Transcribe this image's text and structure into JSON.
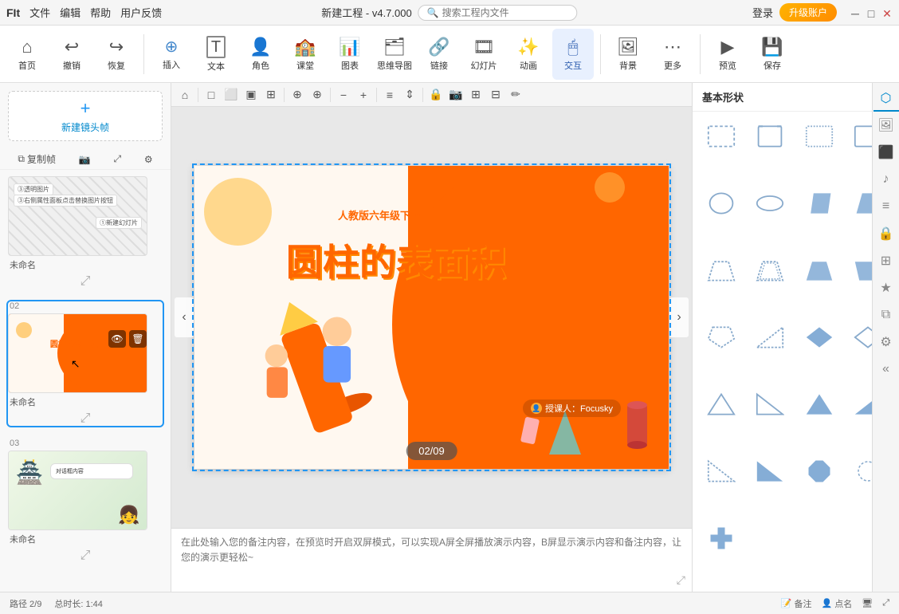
{
  "app": {
    "title": "新建工程 - v4.7.000",
    "search_placeholder": "搜索工程内文件"
  },
  "title_bar": {
    "menus": [
      "FIt",
      "文件",
      "编辑",
      "帮助",
      "用户反馈"
    ],
    "login": "登录",
    "upgrade": "升级账户"
  },
  "toolbar": {
    "items": [
      {
        "id": "home",
        "label": "首页",
        "icon": "⌂"
      },
      {
        "id": "undo",
        "label": "撤销",
        "icon": "↩"
      },
      {
        "id": "redo",
        "label": "恢复",
        "icon": "↪"
      },
      {
        "id": "insert",
        "label": "插入",
        "icon": "⊕"
      },
      {
        "id": "text",
        "label": "文本",
        "icon": "T"
      },
      {
        "id": "role",
        "label": "角色",
        "icon": "👤"
      },
      {
        "id": "class",
        "label": "课堂",
        "icon": "🏫"
      },
      {
        "id": "chart",
        "label": "图表",
        "icon": "📊"
      },
      {
        "id": "mindmap",
        "label": "思维导图",
        "icon": "🗂"
      },
      {
        "id": "link",
        "label": "链接",
        "icon": "🔗"
      },
      {
        "id": "slide",
        "label": "幻灯片",
        "icon": "🎞"
      },
      {
        "id": "animate",
        "label": "动画",
        "icon": "✨"
      },
      {
        "id": "interact",
        "label": "交互",
        "icon": "🖱"
      },
      {
        "id": "bg",
        "label": "背景",
        "icon": "🖼"
      },
      {
        "id": "more",
        "label": "更多",
        "icon": "⋯"
      },
      {
        "id": "preview",
        "label": "预览",
        "icon": "▶"
      },
      {
        "id": "save",
        "label": "保存",
        "icon": "💾"
      }
    ]
  },
  "slides": {
    "new_frame_label": "新建镜头帧",
    "copy_label": "复制帧",
    "items": [
      {
        "num": "",
        "name": "未命名",
        "type": "blank"
      },
      {
        "num": "02",
        "name": "未命名",
        "type": "main",
        "active": true
      },
      {
        "num": "03",
        "name": "未命名",
        "type": "scene"
      }
    ]
  },
  "slide_annotations": {
    "line1": "③透明图片",
    "line2": "③右侧属性面板点击替换图片按钮",
    "line3": "①新建幻灯片"
  },
  "slide_main": {
    "subtitle": "人教版六年级下册",
    "title": "圆柱的表面积",
    "author_label": "授课人：Focusky"
  },
  "canvas_indicator": "02/09",
  "canvas_toolbar_buttons": [
    "⌂",
    "↩",
    "↪",
    "□",
    "□",
    "□",
    "⊕",
    "⊕",
    "−",
    "＋",
    "≡",
    "⇕",
    "🔒",
    "📷",
    "🔲",
    "🔲"
  ],
  "notes_placeholder": "在此处输入您的备注内容，在预览时开启双屏模式，可以实现A屏全屏播放演示内容，B屏显示演示内容和备注内容，让您的演示更轻松~",
  "right_panel": {
    "section_label": "基本形状",
    "dropdown_icon": "▾",
    "tabs": [
      "shape",
      "image",
      "mask",
      "music",
      "text_style",
      "lock",
      "group",
      "star",
      "layers",
      "settings"
    ],
    "shapes_section": "基本形状",
    "shapes": [
      {
        "id": "rect_dashed",
        "type": "rect_dashed"
      },
      {
        "id": "bracket",
        "type": "bracket"
      },
      {
        "id": "rect_dashed2",
        "type": "rect_dashed2"
      },
      {
        "id": "rect_solid",
        "type": "rect_solid"
      },
      {
        "id": "circle",
        "type": "circle"
      },
      {
        "id": "ellipse",
        "type": "ellipse"
      },
      {
        "id": "parallelogram",
        "type": "parallelogram"
      },
      {
        "id": "parallelogram2",
        "type": "parallelogram2"
      },
      {
        "id": "trapezoid",
        "type": "trapezoid"
      },
      {
        "id": "trapezoid2",
        "type": "trapezoid2"
      },
      {
        "id": "pentagon",
        "type": "pentagon"
      },
      {
        "id": "triangle_right",
        "type": "triangle_right"
      },
      {
        "id": "diamond",
        "type": "diamond"
      },
      {
        "id": "diamond2",
        "type": "diamond2"
      },
      {
        "id": "triangle_eq",
        "type": "triangle_eq"
      },
      {
        "id": "triangle_right2",
        "type": "triangle_right2"
      },
      {
        "id": "triangle_solid",
        "type": "triangle_solid"
      },
      {
        "id": "right_triangle",
        "type": "right_triangle"
      },
      {
        "id": "triangle3",
        "type": "triangle3"
      },
      {
        "id": "octagon",
        "type": "octagon"
      },
      {
        "id": "circle_dashed",
        "type": "circle_dashed"
      },
      {
        "id": "plus",
        "type": "plus"
      }
    ]
  },
  "status_bar": {
    "path": "路径 2/9",
    "duration": "总时长: 1:44",
    "note_label": "备注",
    "point_label": "点名"
  }
}
